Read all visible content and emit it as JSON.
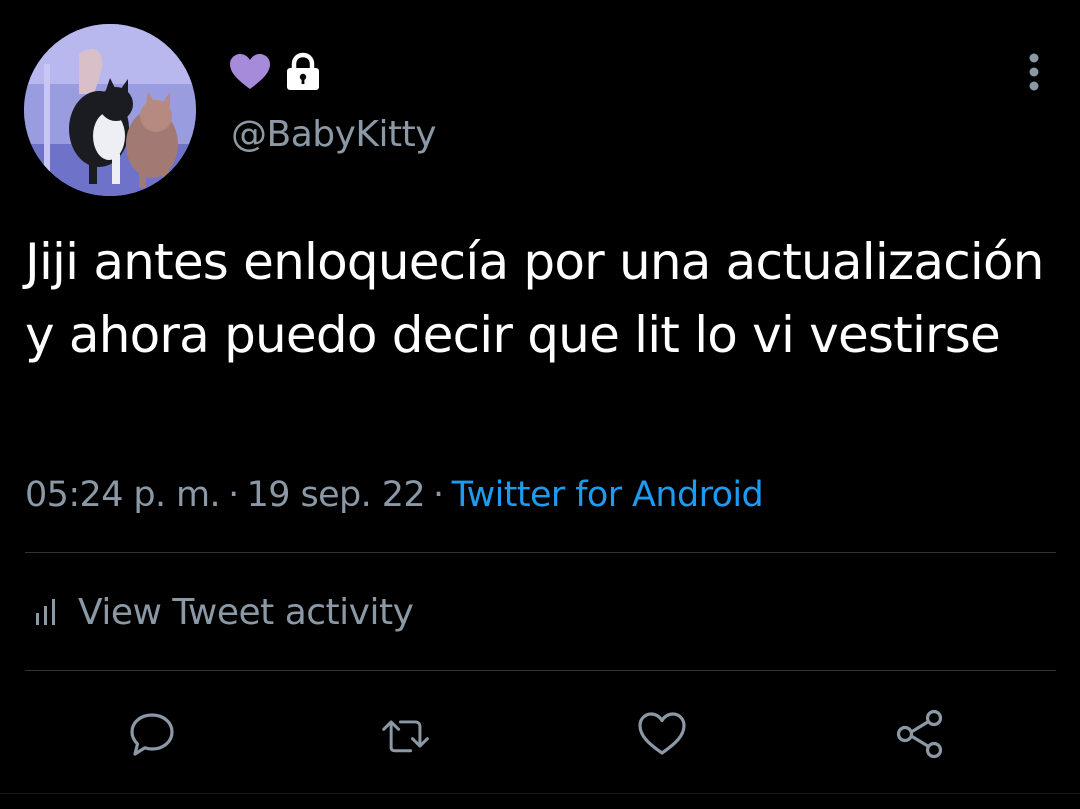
{
  "tweet": {
    "author": {
      "display_name_icons": [
        "purple-heart-icon",
        "lock-icon"
      ],
      "handle": "@BabyKitty",
      "avatar": "avatar-two-cats"
    },
    "text": "Jiji antes enloquecía por una actualización y ahora puedo decir que lit lo vi vestirse",
    "meta": {
      "time": "05:24 p. m.",
      "separator": "·",
      "date": "19 sep. 22",
      "source": "Twitter for Android"
    },
    "activity_label": "View Tweet activity",
    "actions": [
      "reply-icon",
      "retweet-icon",
      "like-icon",
      "share-icon"
    ]
  },
  "colors": {
    "background": "#000000",
    "text_primary": "#ffffff",
    "text_secondary": "#8b98a5",
    "link": "#1d9bf0",
    "divider": "#2f3336",
    "heart": "#a78bdb"
  }
}
